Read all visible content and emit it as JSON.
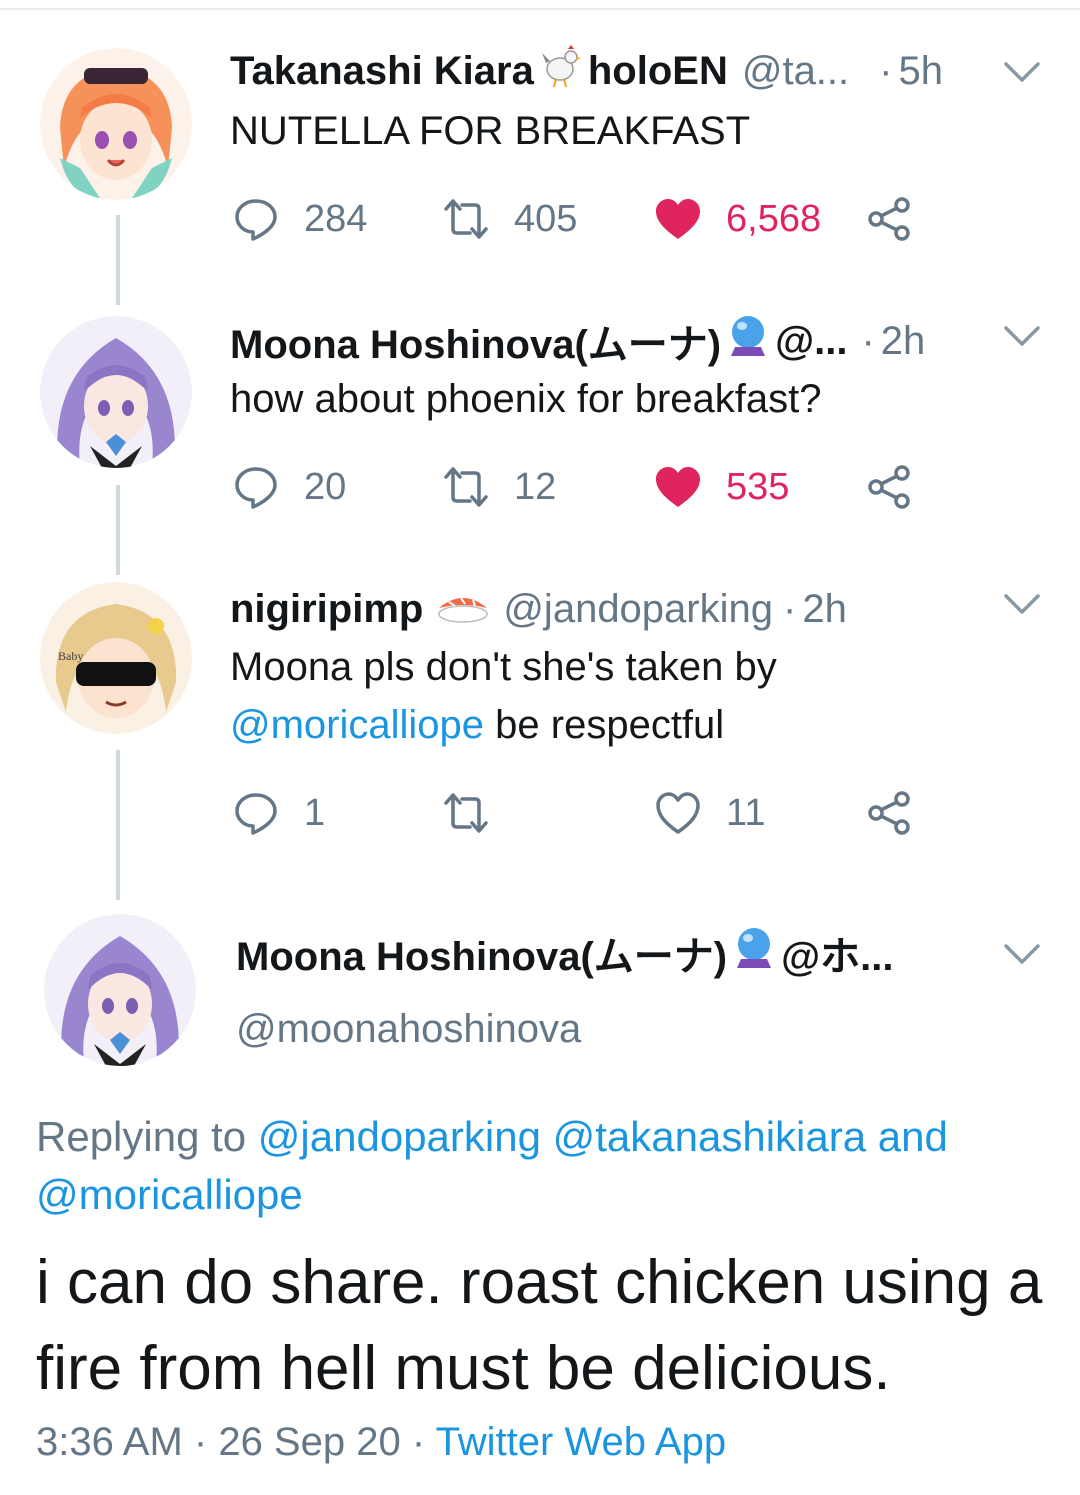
{
  "tweets": [
    {
      "name": "Takanashi Kiara",
      "name_suffix": "holoEN",
      "handle": "@ta...",
      "time": "5h",
      "text": "NUTELLA FOR BREAKFAST",
      "replies": "284",
      "retweets": "405",
      "likes": "6,568",
      "liked": true
    },
    {
      "name": "Moona Hoshinova(ムーナ)",
      "handle": "@...",
      "time": "2h",
      "text": "how about phoenix for breakfast?",
      "replies": "20",
      "retweets": "12",
      "likes": "535",
      "liked": true
    },
    {
      "name": "nigiripimp",
      "handle": "@jandoparking",
      "time": "2h",
      "text": "Moona pls don't she's taken by",
      "mention": "@moricalliope",
      "text_after": "be respectful",
      "replies": "1",
      "retweets": "",
      "likes": "11",
      "liked": false
    }
  ],
  "main_tweet": {
    "name": "Moona Hoshinova(ムーナ)",
    "handle_truncated": "@ホ...",
    "handle": "@moonahoshinova",
    "replying_label": "Replying to",
    "replying_mentions": [
      "@jandoparking",
      "@takanashikiara"
    ],
    "replying_and": "and",
    "replying_last": "@moricalliope",
    "text": "i can do share. roast chicken using a fire from hell must be delicious.",
    "time": "3:36 AM",
    "date": "26 Sep 20",
    "source": "Twitter Web App"
  },
  "icons": {
    "reply": "reply-icon",
    "retweet": "retweet-icon",
    "like": "heart-icon",
    "share": "share-icon",
    "chevron": "chevron-down-icon"
  },
  "colors": {
    "link": "#1b95e0",
    "like": "#e0245e",
    "muted": "#657786",
    "text": "#14171a"
  }
}
